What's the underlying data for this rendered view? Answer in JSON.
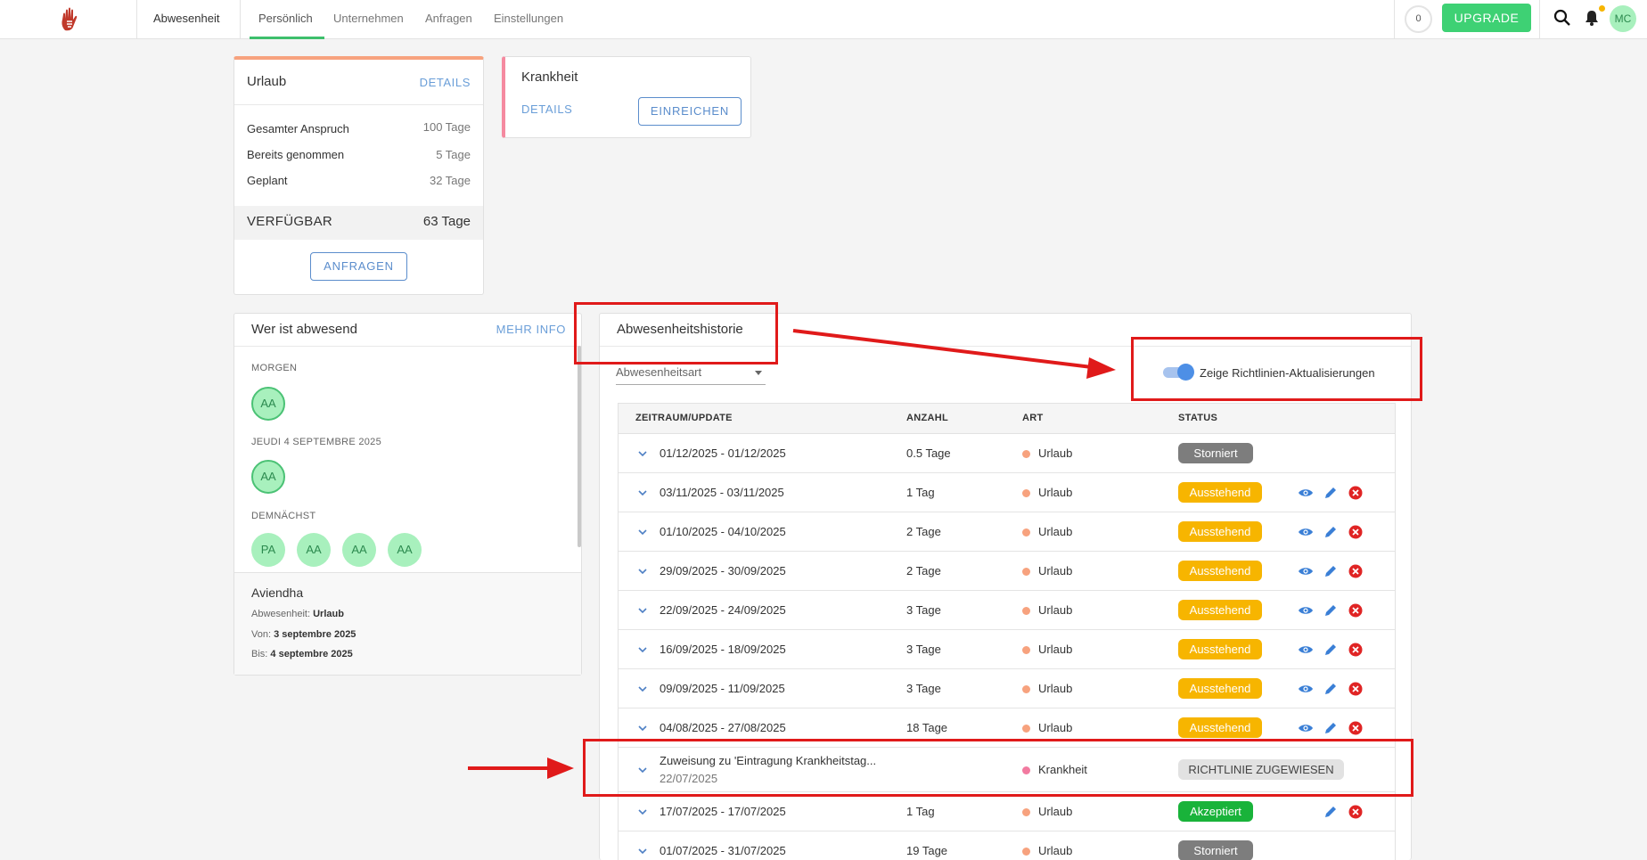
{
  "topbar": {
    "section": "Abwesenheit",
    "tabs": [
      "Persönlich",
      "Unternehmen",
      "Anfragen",
      "Einstellungen"
    ],
    "counter": "0",
    "upgrade_label": "UPGRADE",
    "avatar_initials": "MC"
  },
  "urlaub_card": {
    "title": "Urlaub",
    "details_link": "DETAILS",
    "rows": [
      {
        "label": "Gesamter Anspruch",
        "value": "100 Tage"
      },
      {
        "label": "Bereits genommen",
        "value": "5 Tage"
      },
      {
        "label": "Geplant",
        "value": "32 Tage"
      }
    ],
    "available_label": "VERFÜGBAR",
    "available_value": "63 Tage",
    "request_button": "ANFRAGEN"
  },
  "krankheit_card": {
    "title": "Krankheit",
    "details_link": "DETAILS",
    "submit_button": "EINREICHEN"
  },
  "who_absent": {
    "title": "Wer ist abwesend",
    "more_info": "MEHR INFO",
    "tomorrow_label": "MORGEN",
    "tomorrow_avatars": [
      "AA"
    ],
    "date_label": "JEUDI 4 SEPTEMBRE 2025",
    "date_avatars": [
      "AA"
    ],
    "soon_label": "DEMNÄCHST",
    "soon_avatars": [
      "PA",
      "AA",
      "AA",
      "AA"
    ],
    "selected": {
      "name": "Aviendha",
      "absence_label": "Abwesenheit:",
      "absence_value": "Urlaub",
      "from_label": "Von:",
      "from_value": "3 septembre 2025",
      "to_label": "Bis:",
      "to_value": "4 septembre 2025"
    }
  },
  "history": {
    "title": "Abwesenheitshistorie",
    "filter_placeholder": "Abwesenheitsart",
    "toggle_label": "Zeige Richtlinien-Aktualisierungen",
    "columns": [
      "ZEITRAUM/UPDATE",
      "ANZAHL",
      "ART",
      "STATUS"
    ],
    "rows": [
      {
        "period": "01/12/2025 - 01/12/2025",
        "amount": "0.5 Tage",
        "type": "Urlaub",
        "status": "Storniert"
      },
      {
        "period": "03/11/2025 - 03/11/2025",
        "amount": "1 Tag",
        "type": "Urlaub",
        "status": "Ausstehend"
      },
      {
        "period": "01/10/2025 - 04/10/2025",
        "amount": "2 Tage",
        "type": "Urlaub",
        "status": "Ausstehend"
      },
      {
        "period": "29/09/2025 - 30/09/2025",
        "amount": "2 Tage",
        "type": "Urlaub",
        "status": "Ausstehend"
      },
      {
        "period": "22/09/2025 - 24/09/2025",
        "amount": "3 Tage",
        "type": "Urlaub",
        "status": "Ausstehend"
      },
      {
        "period": "16/09/2025 - 18/09/2025",
        "amount": "3 Tage",
        "type": "Urlaub",
        "status": "Ausstehend"
      },
      {
        "period": "09/09/2025 - 11/09/2025",
        "amount": "3 Tage",
        "type": "Urlaub",
        "status": "Ausstehend"
      },
      {
        "period": "04/08/2025 - 27/08/2025",
        "amount": "18 Tage",
        "type": "Urlaub",
        "status": "Ausstehend"
      },
      {
        "period": "Zuweisung zu 'Eintragung Krankheitstag...",
        "date": "22/07/2025",
        "type": "Krankheit",
        "status": "RICHTLINIE ZUGEWIESEN"
      },
      {
        "period": "17/07/2025 - 17/07/2025",
        "amount": "1 Tag",
        "type": "Urlaub",
        "status": "Akzeptiert"
      },
      {
        "period": "01/07/2025 - 31/07/2025",
        "amount": "19 Tage",
        "type": "Urlaub",
        "status": "Storniert"
      }
    ]
  },
  "colors": {
    "accent_green": "#3ed174",
    "link_blue": "#5b8dcc",
    "status_cancelled": "#7d7d7d",
    "status_pending": "#f7b500",
    "status_accepted": "#19b33a",
    "status_policy": "#e2e2e2",
    "dot_vacation": "#f7a27e",
    "dot_sick": "#f27aa0",
    "annotation_red": "#e01a1a"
  }
}
